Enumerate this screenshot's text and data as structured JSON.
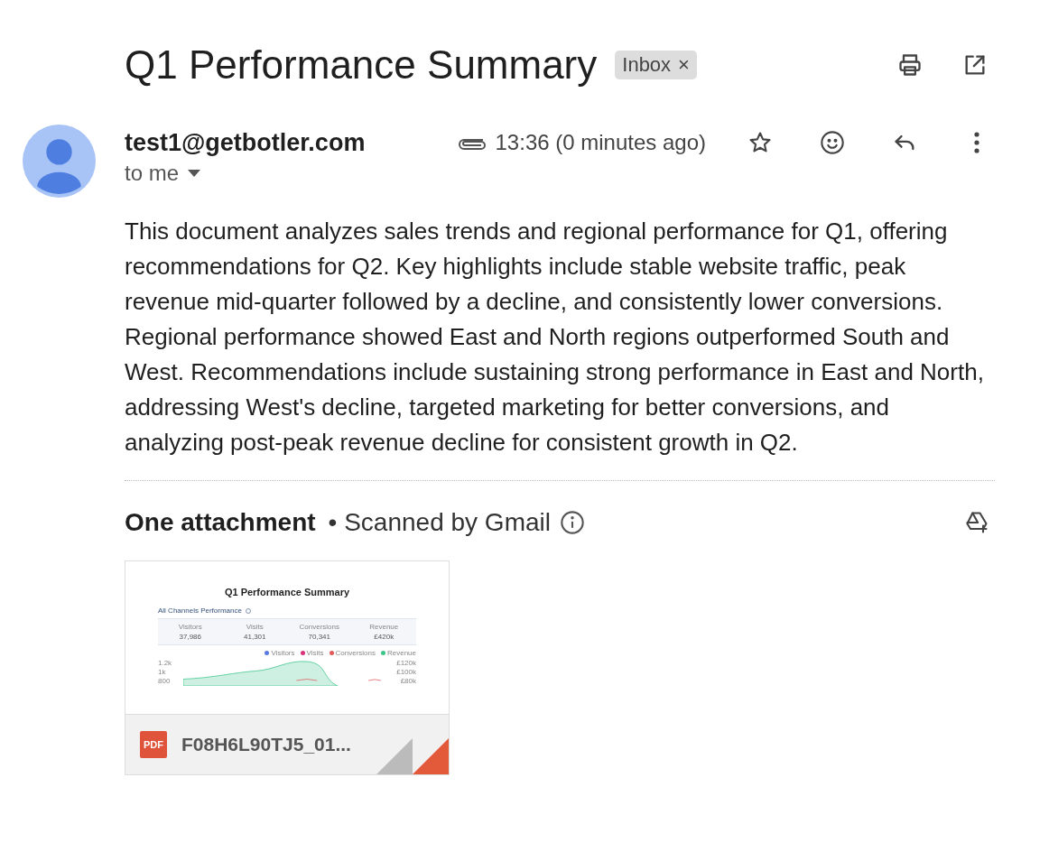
{
  "subject": "Q1 Performance Summary",
  "label": {
    "text": "Inbox",
    "close": "×"
  },
  "sender": {
    "address": "test1@getbotler.com",
    "recipient": "to me",
    "time": "13:36 (0 minutes ago)",
    "has_attachment": true,
    "starred": false
  },
  "body": "This document analyzes sales trends and regional performance for Q1, offering recommendations for Q2. Key highlights include stable website traffic, peak revenue mid-quarter followed by a decline, and consistently lower conversions. Regional performance showed East and North regions outperformed South and West. Recommendations include sustaining strong performance in East and North, addressing West's decline, targeted marketing for better conversions, and analyzing post-peak revenue decline for consistent growth in Q2.",
  "attachments_header": {
    "title": "One attachment",
    "scan_note": "• Scanned by Gmail"
  },
  "attachment": {
    "file_name": "F08H6L90TJ5_01...",
    "file_type": "PDF",
    "preview": {
      "title": "Q1 Performance Summary",
      "section": "All Channels Performance",
      "stats": [
        {
          "label": "Visitors",
          "value": "37,986"
        },
        {
          "label": "Visits",
          "value": "41,301"
        },
        {
          "label": "Conversions",
          "value": "70,341"
        },
        {
          "label": "Revenue",
          "value": "£420k"
        }
      ],
      "legend": [
        {
          "label": "Visitors",
          "color": "#5b7be0"
        },
        {
          "label": "Visits",
          "color": "#d6337a"
        },
        {
          "label": "Conversions",
          "color": "#e05a5a"
        },
        {
          "label": "Revenue",
          "color": "#3cc48a"
        }
      ],
      "left_ticks": [
        "1.2k",
        "1k",
        "800"
      ],
      "right_ticks": [
        "£120k",
        "£100k",
        "£80k"
      ]
    }
  }
}
